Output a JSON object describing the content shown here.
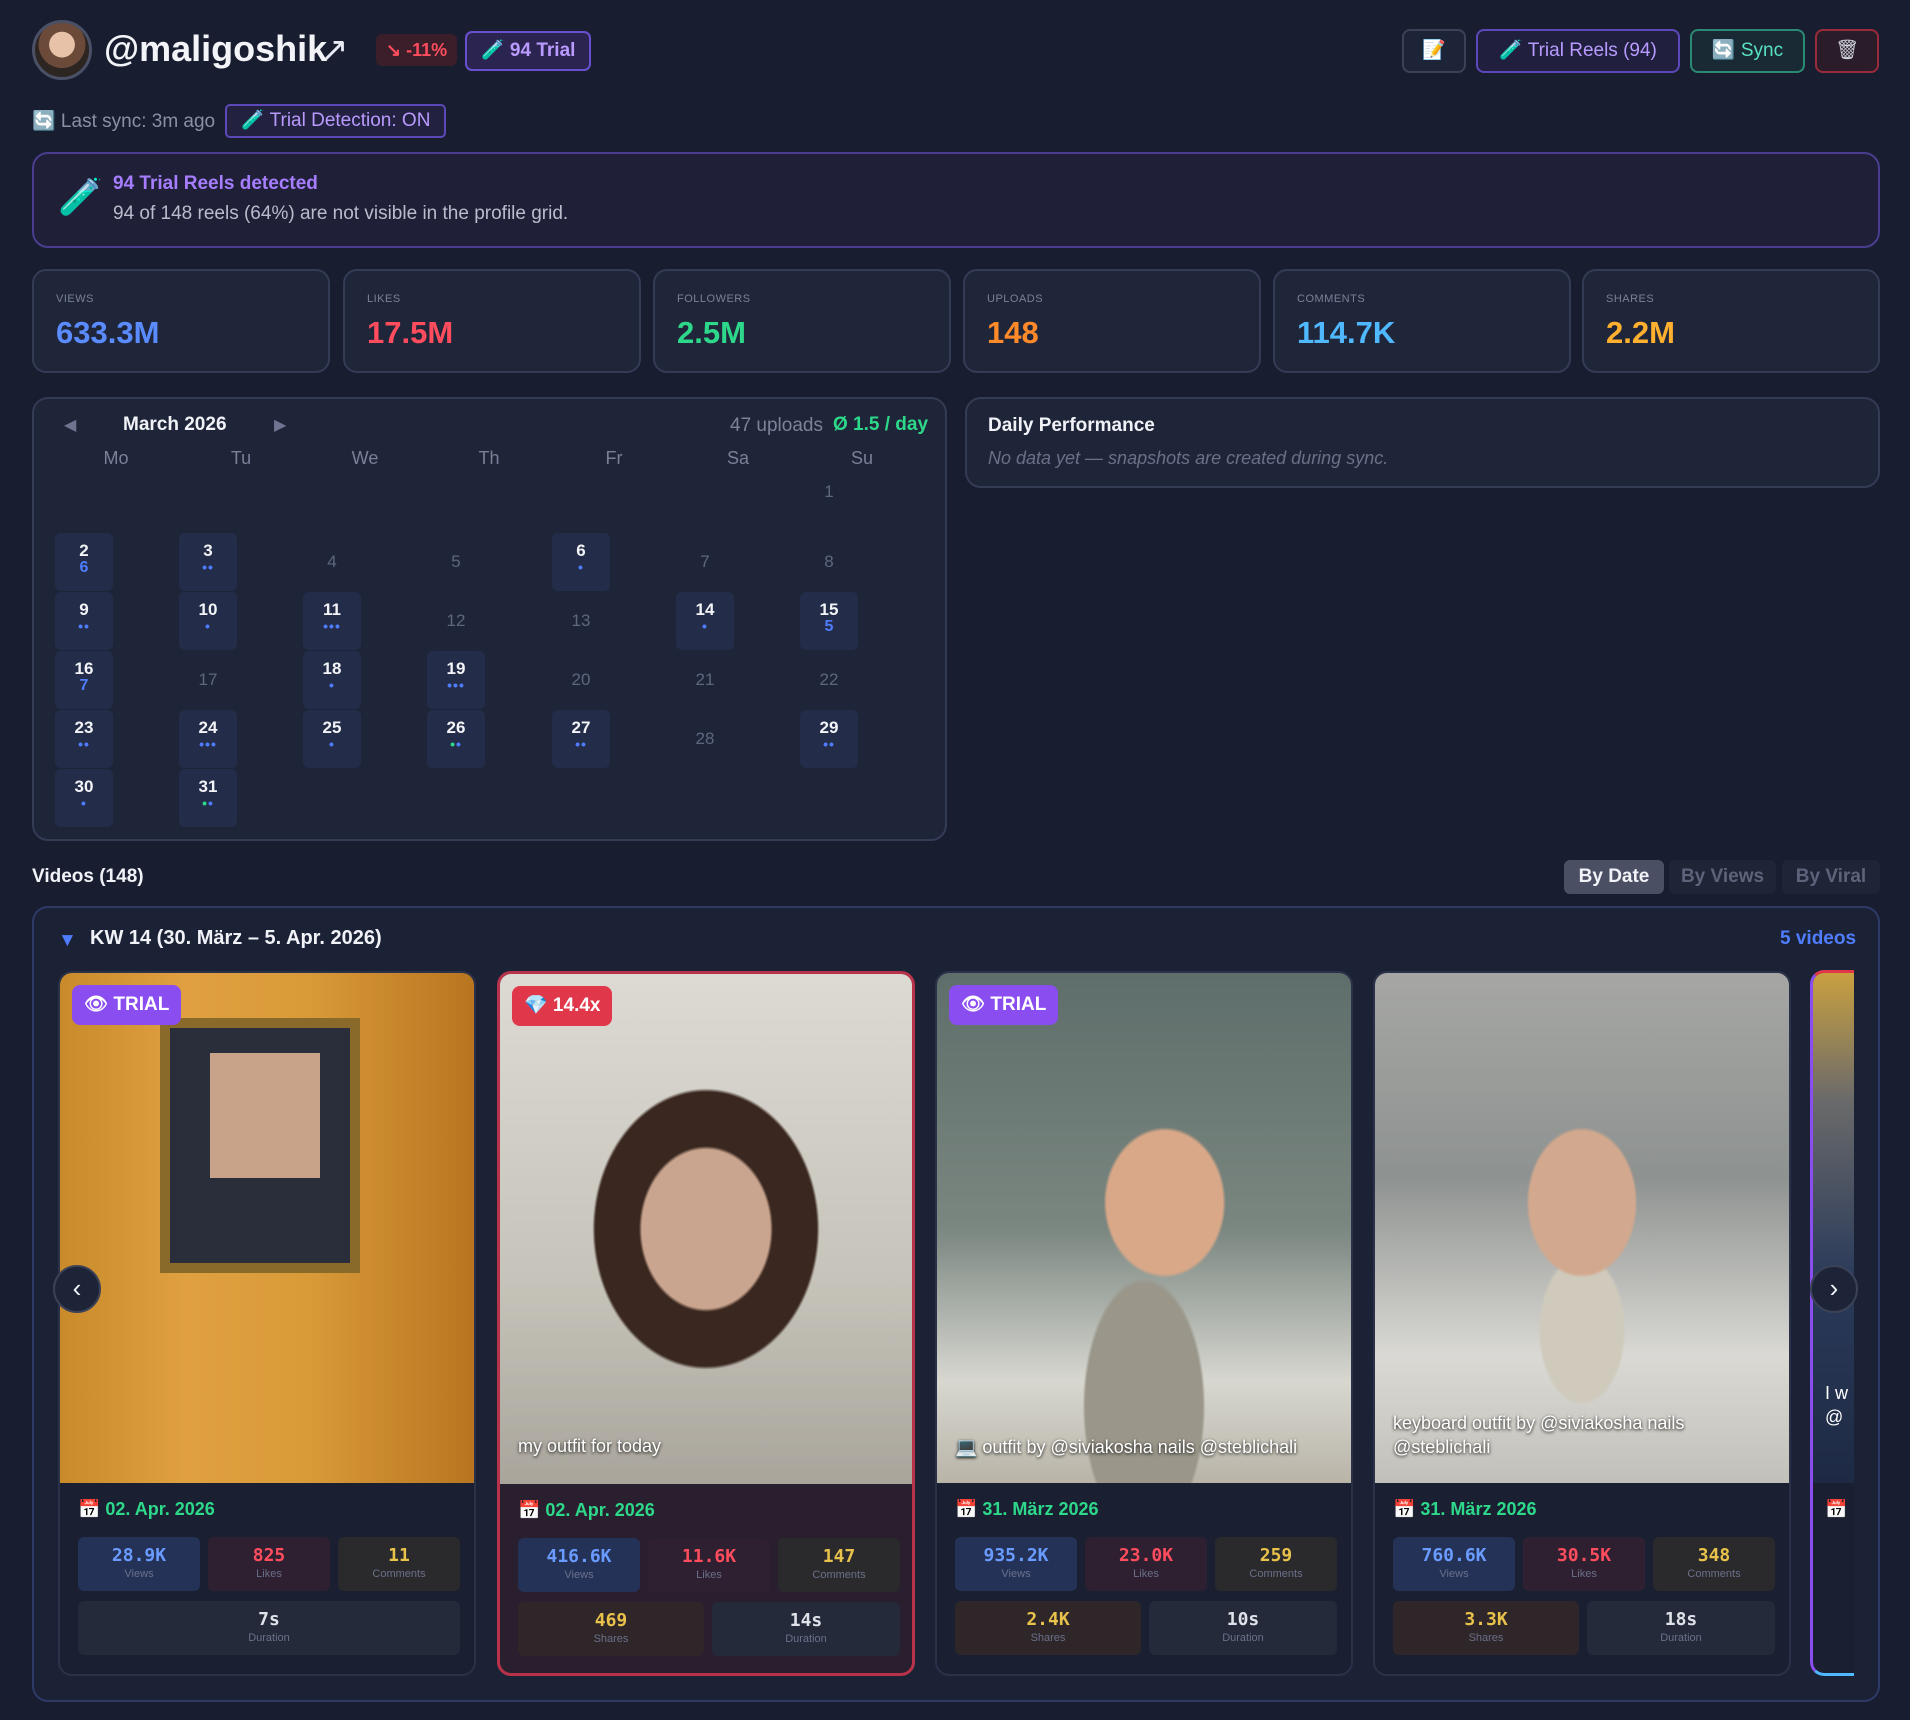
{
  "profile": {
    "username": "@maligoshik",
    "trend": "↘ -11%",
    "trial_badge": "🧪 94 Trial",
    "last_sync": "🔄 Last sync: 3m ago",
    "detection": "🧪 Trial Detection: ON"
  },
  "toolbar": {
    "note_label": "📝",
    "trial_reels_label": "🧪 Trial Reels (94)",
    "sync_label": "🔄 Sync",
    "delete_label": "🗑"
  },
  "banner": {
    "icon": "🧪",
    "title": "94 Trial Reels detected",
    "subtitle": "94 of 148 reels (64%) are not visible in the profile grid."
  },
  "stats": [
    {
      "label": "VIEWS",
      "value": "633.3M",
      "color": "#5a8bff"
    },
    {
      "label": "LIKES",
      "value": "17.5M",
      "color": "#ff4d5e"
    },
    {
      "label": "FOLLOWERS",
      "value": "2.5M",
      "color": "#2ed88a"
    },
    {
      "label": "UPLOADS",
      "value": "148",
      "color": "#ff8a2a"
    },
    {
      "label": "COMMENTS",
      "value": "114.7K",
      "color": "#4fb8ff"
    },
    {
      "label": "SHARES",
      "value": "2.2M",
      "color": "#ffb02e"
    }
  ],
  "calendar": {
    "prev": "◀",
    "next": "▶",
    "month": "March 2026",
    "uploads": "47 uploads",
    "rate": "Ø 1.5 / day",
    "weekdays": [
      "Mo",
      "Tu",
      "We",
      "Th",
      "Fr",
      "Sa",
      "Su"
    ],
    "days": {
      "d1": "1",
      "d2": "2",
      "d2s": "6",
      "d3": "3",
      "d4": "4",
      "d5": "5",
      "d6": "6",
      "d7": "7",
      "d8": "8",
      "d9": "9",
      "d10": "10",
      "d11": "11",
      "d12": "12",
      "d13": "13",
      "d14": "14",
      "d15": "15",
      "d15s": "5",
      "d16": "16",
      "d16s": "7",
      "d17": "17",
      "d18": "18",
      "d19": "19",
      "d20": "20",
      "d21": "21",
      "d22": "22",
      "d23": "23",
      "d24": "24",
      "d25": "25",
      "d26": "26",
      "d27": "27",
      "d28": "28",
      "d29": "29",
      "d30": "30",
      "d31": "31"
    }
  },
  "performance": {
    "title": "Daily Performance",
    "subtitle": "No data yet — snapshots are created during sync."
  },
  "videos": {
    "title": "Videos (148)",
    "sort": [
      "By Date",
      "By Views",
      "By Viral"
    ],
    "week_toggle": "▼",
    "week_title": "KW 14 (30. März – 5. Apr. 2026)",
    "week_count": "5 videos",
    "prev_arrow": "‹",
    "next_arrow": "›",
    "metric_labels": {
      "views": "Views",
      "likes": "Likes",
      "comments": "Comments",
      "shares": "Shares",
      "duration": "Duration"
    },
    "cards": [
      {
        "tag": "👁 TRIAL",
        "caption": "",
        "date": "📅 02. Apr. 2026",
        "views": "28.9K",
        "likes": "825",
        "comments": "11",
        "duration": "7s"
      },
      {
        "tag": "💎 14.4x",
        "caption": "my outfit for today",
        "date": "📅 02. Apr. 2026",
        "views": "416.6K",
        "likes": "11.6K",
        "comments": "147",
        "shares": "469",
        "duration": "14s"
      },
      {
        "tag": "👁 TRIAL",
        "caption": "💻 outfit by @siviakosha nails @steblichali",
        "date": "📅 31. März 2026",
        "views": "935.2K",
        "likes": "23.0K",
        "comments": "259",
        "shares": "2.4K",
        "duration": "10s"
      },
      {
        "tag": "",
        "caption": "keyboard outfit by @siviakosha nails @steblichali",
        "date": "📅 31. März 2026",
        "views": "760.6K",
        "likes": "30.5K",
        "comments": "348",
        "shares": "3.3K",
        "duration": "18s"
      }
    ],
    "partial_card": {
      "caption": "I w @",
      "date": "📅"
    }
  }
}
